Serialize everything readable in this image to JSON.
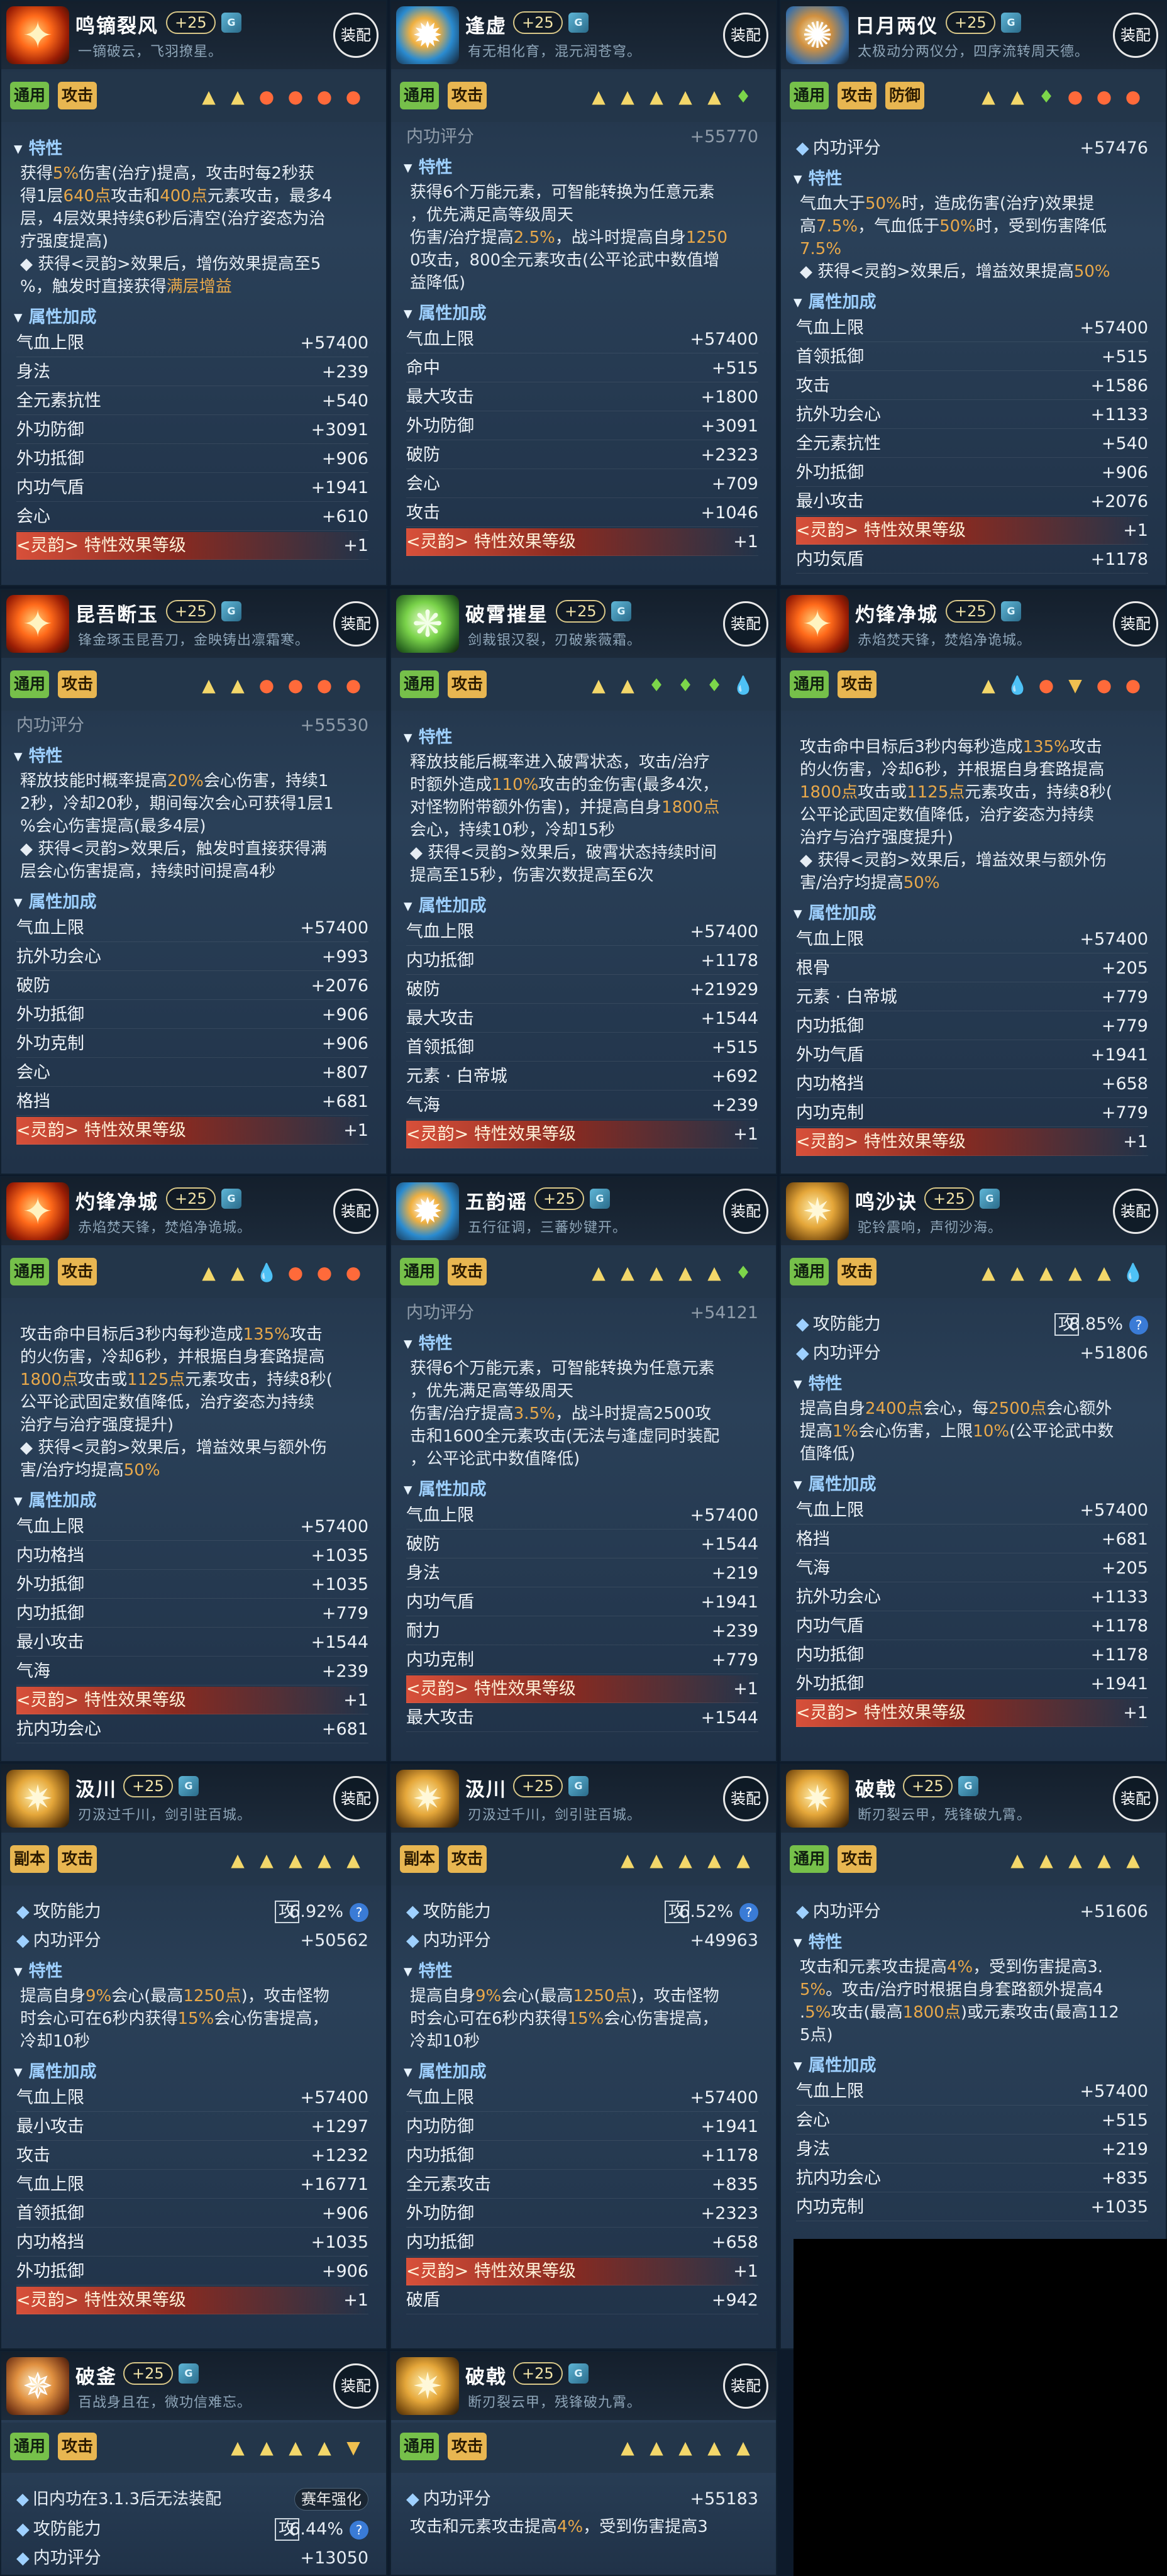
{
  "cards": [
    {
      "name": "鸣镝裂风",
      "level": "+25",
      "gem": "G",
      "subtitle": "一镝破云，飞羽撩星。",
      "equip": "装配",
      "tags": [
        "通用",
        "攻击"
      ],
      "symbols": [
        "triangle",
        "triangle",
        "fire",
        "fire",
        "fire",
        "fire"
      ],
      "sections": {
        "trait": "特性",
        "attr": "属性加成"
      },
      "trait_lines": [
        "获得5%伤害(治疗)提高，攻击时每2秒获",
        "得1层640点攻击和400点元素攻击，最多4",
        "层，4层效果持续6秒后清空(治疗姿态为治",
        "疗强度提高)",
        "◆ 获得<灵韵>效果后，增伤效果提高至5",
        "%，触发时直接获得满层增益"
      ],
      "attrs": [
        {
          "k": "气血上限",
          "v": "+57400"
        },
        {
          "k": "身法",
          "v": "+239"
        },
        {
          "k": "全元素抗性",
          "v": "+540"
        },
        {
          "k": "外功防御",
          "v": "+3091"
        },
        {
          "k": "外功抵御",
          "v": "+906"
        },
        {
          "k": "内功气盾",
          "v": "+1941"
        },
        {
          "k": "会心",
          "v": "+610"
        },
        {
          "k": "<灵韵> 特性效果等级",
          "v": "+1",
          "red": true
        }
      ]
    },
    {
      "name": "逢虚",
      "level": "+25",
      "gem": "G",
      "subtitle": "有无相化育，混元润苍穹。",
      "equip": "装配",
      "tags": [
        "通用",
        "攻击"
      ],
      "symbols": [
        "triangle",
        "triangle",
        "triangle",
        "triangle",
        "triangle",
        "leaf"
      ],
      "cut_top": "内功评分",
      "cut_val": "+55770",
      "sections": {
        "trait": "特性",
        "attr": "属性加成"
      },
      "trait_lines": [
        "获得6个万能元素，可智能转换为任意元素",
        "，优先满足高等级周天",
        "伤害/治疗提高2.5%，战斗时提高自身1250",
        "0攻击，800全元素攻击(公平论武中数值增",
        "益降低)"
      ],
      "attrs": [
        {
          "k": "气血上限",
          "v": "+57400"
        },
        {
          "k": "命中",
          "v": "+515"
        },
        {
          "k": "最大攻击",
          "v": "+1800"
        },
        {
          "k": "外功防御",
          "v": "+3091"
        },
        {
          "k": "破防",
          "v": "+2323"
        },
        {
          "k": "会心",
          "v": "+709"
        },
        {
          "k": "攻击",
          "v": "+1046"
        },
        {
          "k": "<灵韵> 特性效果等级",
          "v": "+1",
          "red": true
        }
      ]
    },
    {
      "name": "日月两仪",
      "level": "+25",
      "gem": "G",
      "subtitle": "太极动分两仪分，四序流转周天德。",
      "equip": "装配",
      "tags": [
        "通用",
        "攻击",
        "防御"
      ],
      "symbols": [
        "triangle",
        "triangle",
        "leaf",
        "fire",
        "fire",
        "fire"
      ],
      "score_label": "内功评分",
      "score_val": "+57476",
      "sections": {
        "trait": "特性",
        "attr": "属性加成"
      },
      "trait_lines": [
        "气血大于50%时，造成伤害(治疗)效果提",
        "高7.5%，气血低于50%时，受到伤害降低",
        "7.5%",
        "◆ 获得<灵韵>效果后，增益效果提高50%"
      ],
      "attrs": [
        {
          "k": "气血上限",
          "v": "+57400"
        },
        {
          "k": "首领抵御",
          "v": "+515"
        },
        {
          "k": "攻击",
          "v": "+1586"
        },
        {
          "k": "抗外功会心",
          "v": "+1133"
        },
        {
          "k": "全元素抗性",
          "v": "+540"
        },
        {
          "k": "外功抵御",
          "v": "+906"
        },
        {
          "k": "最小攻击",
          "v": "+2076"
        },
        {
          "k": "<灵韵> 特性效果等级",
          "v": "+1",
          "red": true
        },
        {
          "k": "内功気盾",
          "v": "+1178"
        }
      ]
    },
    {
      "name": "昆吾断玉",
      "level": "+25",
      "gem": "G",
      "subtitle": "锋金琢玉昆吾刀，金映铸出凛霜寒。",
      "equip": "装配",
      "tags": [
        "通用",
        "攻击"
      ],
      "symbols": [
        "triangle",
        "triangle",
        "fire",
        "fire",
        "fire",
        "fire"
      ],
      "cut_top": "内功评分",
      "cut_val": "+55530",
      "sections": {
        "trait": "特性",
        "attr": "属性加成"
      },
      "trait_lines": [
        "释放技能时概率提高20%会心伤害，持续1",
        "2秒，冷却20秒，期间每次会心可获得1层1",
        "%会心伤害提高(最多4层)",
        "◆ 获得<灵韵>效果后，触发时直接获得满",
        "层会心伤害提高，持续时间提高4秒"
      ],
      "attrs": [
        {
          "k": "气血上限",
          "v": "+57400"
        },
        {
          "k": "抗外功会心",
          "v": "+993"
        },
        {
          "k": "破防",
          "v": "+2076"
        },
        {
          "k": "外功抵御",
          "v": "+906"
        },
        {
          "k": "外功克制",
          "v": "+906"
        },
        {
          "k": "会心",
          "v": "+807"
        },
        {
          "k": "格挡",
          "v": "+681"
        },
        {
          "k": "<灵韵> 特性效果等级",
          "v": "+1",
          "red": true
        }
      ]
    },
    {
      "name": "破霄摧星",
      "level": "+25",
      "gem": "G",
      "subtitle": "剑裁银汉裂，刃破紫薇霜。",
      "equip": "装配",
      "tags": [
        "通用",
        "攻击"
      ],
      "symbols": [
        "triangle",
        "triangle",
        "leaf",
        "leaf",
        "leaf",
        "drop"
      ],
      "sections": {
        "trait": "特性",
        "attr": "属性加成"
      },
      "trait_lines": [
        "释放技能后概率进入破霄状态，攻击/治疗",
        "时额外造成110%攻击的金伤害(最多4次，",
        "对怪物附带额外伤害)，并提高自身1800点",
        "会心，持续10秒，冷却15秒",
        "◆ 获得<灵韵>效果后，破霄状态持续时间",
        "提高至15秒，伤害次数提高至6次"
      ],
      "attrs": [
        {
          "k": "气血上限",
          "v": "+57400"
        },
        {
          "k": "内功抵御",
          "v": "+1178"
        },
        {
          "k": "破防",
          "v": "+21929"
        },
        {
          "k": "最大攻击",
          "v": "+1544"
        },
        {
          "k": "首领抵御",
          "v": "+515"
        },
        {
          "k": "元素 · 白帝城",
          "v": "+692"
        },
        {
          "k": "气海",
          "v": "+239"
        },
        {
          "k": "<灵韵> 特性效果等级",
          "v": "+1",
          "red": true
        }
      ]
    },
    {
      "name": "灼锋净城",
      "level": "+25",
      "gem": "G",
      "subtitle": "赤焰焚天锋，焚焰净诡城。",
      "equip": "装配",
      "tags": [
        "通用",
        "攻击"
      ],
      "symbols": [
        "triangle",
        "drop",
        "fire",
        "cup",
        "fire",
        "fire"
      ],
      "sections": {
        "trait": "",
        "attr": "属性加成"
      },
      "trait_lines": [
        "攻击命中目标后3秒内每秒造成135%攻击",
        "的火伤害，冷却6秒，并根据自身套路提高",
        "1800点攻击或1125点元素攻击，持续8秒(",
        "公平论武固定数值降低，治疗姿态为持续",
        "治疗与治疗强度提升)",
        "◆ 获得<灵韵>效果后，增益效果与额外伤",
        "害/治疗均提高50%"
      ],
      "attrs": [
        {
          "k": "气血上限",
          "v": "+57400"
        },
        {
          "k": "根骨",
          "v": "+205"
        },
        {
          "k": "元素 · 白帝城",
          "v": "+779"
        },
        {
          "k": "内功抵御",
          "v": "+779"
        },
        {
          "k": "外功气盾",
          "v": "+1941"
        },
        {
          "k": "内功格挡",
          "v": "+658"
        },
        {
          "k": "内功克制",
          "v": "+779"
        },
        {
          "k": "<灵韵> 特性效果等级",
          "v": "+1",
          "red": true
        }
      ]
    },
    {
      "name": "灼锋净城",
      "level": "+25",
      "gem": "G",
      "subtitle": "赤焰焚天锋，焚焰净诡城。",
      "equip": "装配",
      "tags": [
        "通用",
        "攻击"
      ],
      "symbols": [
        "triangle",
        "triangle",
        "drop",
        "fire",
        "fire",
        "fire"
      ],
      "sections": {
        "trait": "",
        "attr": "属性加成"
      },
      "trait_lines": [
        "攻击命中目标后3秒内每秒造成135%攻击",
        "的火伤害，冷却6秒，并根据自身套路提高",
        "1800点攻击或1125点元素攻击，持续8秒(",
        "公平论武固定数值降低，治疗姿态为持续",
        "治疗与治疗强度提升)",
        "◆ 获得<灵韵>效果后，增益效果与额外伤",
        "害/治疗均提高50%"
      ],
      "attrs": [
        {
          "k": "气血上限",
          "v": "+57400"
        },
        {
          "k": "内功格挡",
          "v": "+1035"
        },
        {
          "k": "外功抵御",
          "v": "+1035"
        },
        {
          "k": "内功抵御",
          "v": "+779"
        },
        {
          "k": "最小攻击",
          "v": "+1544"
        },
        {
          "k": "气海",
          "v": "+239"
        },
        {
          "k": "<灵韵> 特性效果等级",
          "v": "+1",
          "red": true
        },
        {
          "k": "抗内功会心",
          "v": "+681"
        }
      ]
    },
    {
      "name": "五韵谣",
      "level": "+25",
      "gem": "G",
      "subtitle": "五行征调，三蕃妙键开。",
      "equip": "装配",
      "tags": [
        "通用",
        "攻击"
      ],
      "symbols": [
        "triangle",
        "triangle",
        "triangle",
        "triangle",
        "triangle",
        "leaf"
      ],
      "cut_top": "内功评分",
      "cut_val": "+54121",
      "sections": {
        "trait": "特性",
        "attr": "属性加成"
      },
      "trait_lines": [
        "获得6个万能元素，可智能转换为任意元素",
        "，优先满足高等级周天",
        "伤害/治疗提高3.5%，战斗时提高2500攻",
        "击和1600全元素攻击(无法与逢虚同时装配",
        "，公平论武中数值降低)"
      ],
      "attrs": [
        {
          "k": "气血上限",
          "v": "+57400"
        },
        {
          "k": "破防",
          "v": "+1544"
        },
        {
          "k": "身法",
          "v": "+219"
        },
        {
          "k": "内功气盾",
          "v": "+1941"
        },
        {
          "k": "耐力",
          "v": "+239"
        },
        {
          "k": "内功克制",
          "v": "+779"
        },
        {
          "k": "<灵韵> 特性效果等级",
          "v": "+1",
          "red": true
        },
        {
          "k": "最大攻击",
          "v": "+1544"
        }
      ]
    },
    {
      "name": "鸣沙诀",
      "level": "+25",
      "gem": "G",
      "subtitle": "驼铃震响，声彻沙海。",
      "equip": "装配",
      "tags": [
        "通用",
        "攻击"
      ],
      "symbols": [
        "triangle",
        "triangle",
        "triangle",
        "triangle",
        "triangle",
        "drop"
      ],
      "atk_label": "攻防能力",
      "atk_box": "攻",
      "atk_pct": "8.85%",
      "score_label": "内功评分",
      "score_val": "+51806",
      "sections": {
        "trait": "特性",
        "attr": "属性加成"
      },
      "trait_lines": [
        "提高自身2400点会心，每2500点会心额外",
        "提高1%会心伤害，上限10%(公平论武中数",
        "值降低)"
      ],
      "attrs": [
        {
          "k": "气血上限",
          "v": "+57400"
        },
        {
          "k": "格挡",
          "v": "+681"
        },
        {
          "k": "气海",
          "v": "+205"
        },
        {
          "k": "抗外功会心",
          "v": "+1133"
        },
        {
          "k": "内功气盾",
          "v": "+1178"
        },
        {
          "k": "内功抵御",
          "v": "+1178"
        },
        {
          "k": "外功抵御",
          "v": "+1941"
        },
        {
          "k": "<灵韵> 特性效果等级",
          "v": "+1",
          "red": true
        }
      ]
    },
    {
      "name": "汲川",
      "level": "+25",
      "gem": "G",
      "subtitle": "刃汲过千川，剑引驻百城。",
      "equip": "装配",
      "tags": [
        "副本",
        "攻击"
      ],
      "symbols": [
        "triangle",
        "triangle",
        "triangle",
        "triangle",
        "triangle"
      ],
      "atk_label": "攻防能力",
      "atk_box": "攻",
      "atk_pct": "6.92%",
      "score_label": "内功评分",
      "score_val": "+50562",
      "sections": {
        "trait": "特性",
        "attr": "属性加成"
      },
      "trait_lines": [
        "提高自身9%会心(最高1250点)，攻击怪物",
        "时会心可在6秒内获得15%会心伤害提高，",
        "冷却10秒"
      ],
      "attrs": [
        {
          "k": "气血上限",
          "v": "+57400"
        },
        {
          "k": "最小攻击",
          "v": "+1297"
        },
        {
          "k": "攻击",
          "v": "+1232"
        },
        {
          "k": "气血上限",
          "v": "+16771"
        },
        {
          "k": "首领抵御",
          "v": "+906"
        },
        {
          "k": "内功格挡",
          "v": "+1035"
        },
        {
          "k": "外功抵御",
          "v": "+906"
        },
        {
          "k": "<灵韵> 特性效果等级",
          "v": "+1",
          "red": true
        }
      ]
    },
    {
      "name": "汲川",
      "level": "+25",
      "gem": "G",
      "subtitle": "刃汲过千川，剑引驻百城。",
      "equip": "装配",
      "tags": [
        "副本",
        "攻击"
      ],
      "symbols": [
        "triangle",
        "triangle",
        "triangle",
        "triangle",
        "triangle"
      ],
      "atk_label": "攻防能力",
      "atk_box": "攻",
      "atk_pct": "6.52%",
      "score_label": "内功评分",
      "score_val": "+49963",
      "sections": {
        "trait": "特性",
        "attr": "属性加成"
      },
      "trait_lines": [
        "提高自身9%会心(最高1250点)，攻击怪物",
        "时会心可在6秒内获得15%会心伤害提高，",
        "冷却10秒"
      ],
      "attrs": [
        {
          "k": "气血上限",
          "v": "+57400"
        },
        {
          "k": "内功防御",
          "v": "+1941"
        },
        {
          "k": "内功抵御",
          "v": "+1178"
        },
        {
          "k": "全元素攻击",
          "v": "+835"
        },
        {
          "k": "外功防御",
          "v": "+2323"
        },
        {
          "k": "内功抵御",
          "v": "+658"
        },
        {
          "k": "<灵韵> 特性效果等级",
          "v": "+1",
          "red": true
        },
        {
          "k": "破盾",
          "v": "+942"
        }
      ]
    },
    {
      "name": "破戟",
      "level": "+25",
      "gem": "G",
      "subtitle": "断刃裂云甲，残锋破九霄。",
      "equip": "装配",
      "tags": [
        "通用",
        "攻击"
      ],
      "symbols": [
        "triangle",
        "triangle",
        "triangle",
        "triangle",
        "triangle"
      ],
      "score_label": "内功评分",
      "score_val": "+51606",
      "sections": {
        "trait": "特性",
        "attr": "属性加成"
      },
      "trait_lines": [
        "攻击和元素攻击提高4%，受到伤害提高3.",
        "5%。攻击/治疗时根据自身套路额外提高4",
        ".5%攻击(最高1800点)或元素攻击(最高112",
        "5点)"
      ],
      "attrs": [
        {
          "k": "气血上限",
          "v": "+57400"
        },
        {
          "k": "会心",
          "v": "+515"
        },
        {
          "k": "身法",
          "v": "+219"
        },
        {
          "k": "抗内功会心",
          "v": "+835"
        },
        {
          "k": "内功克制",
          "v": "+1035"
        }
      ]
    },
    {
      "name": "破釜",
      "level": "+25",
      "gem": "G",
      "subtitle": "百战身且在，微功信难忘。",
      "equip": "装配",
      "tags": [
        "通用",
        "攻击"
      ],
      "symbols": [
        "triangle",
        "triangle",
        "triangle",
        "triangle",
        "cup"
      ],
      "strip_label": "旧内功在3.1.3后无法装配",
      "strip_btn": "赛年强化",
      "atk_label": "攻防能力",
      "atk_box": "攻",
      "atk_pct": "6.44%",
      "score_label": "内功评分",
      "score_val": "+13050"
    },
    {
      "name": "破戟",
      "level": "+25",
      "gem": "G",
      "subtitle": "断刃裂云甲，残锋破九霄。",
      "equip": "装配",
      "tags": [
        "通用",
        "攻击"
      ],
      "symbols": [
        "triangle",
        "triangle",
        "triangle",
        "triangle",
        "triangle"
      ],
      "score_label": "内功评分",
      "score_val": "+55183",
      "trait_lines": [
        "攻击和元素攻击提高4%，受到伤害提高3"
      ]
    }
  ],
  "icons": [
    "fire-icon",
    "orb-icon",
    "gear-icon",
    "fire-icon",
    "green-leaf-icon",
    "fire-icon",
    "fire-icon",
    "orb-icon",
    "gold-icon",
    "gold-icon",
    "gold-icon",
    "gold-icon",
    "tree-icon",
    "gold-icon"
  ],
  "colors": {
    "accent": "#e8a84a",
    "tag_green": "#76c04a",
    "tag_yellow": "#e8b651",
    "section": "#9ed0ff",
    "red_bar": "#d8503a"
  }
}
